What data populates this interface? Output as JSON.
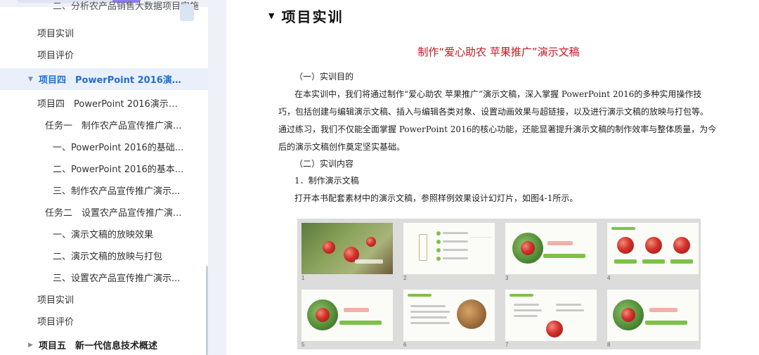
{
  "sidebar": {
    "items": [
      {
        "label": "二、分析农产品销售大数据项目实施",
        "level": "l3"
      },
      {
        "label": "项目实训",
        "level": "l1"
      },
      {
        "label": "项目评价",
        "level": "l1"
      },
      {
        "label": "项目四　PowerPoint 2016演示文...",
        "level": "chapter",
        "state": "expanded",
        "active": true
      },
      {
        "label": "项目四　PowerPoint 2016演示文...",
        "level": "l1"
      },
      {
        "label": "任务一　制作农产品宣传推广演...",
        "level": "l2"
      },
      {
        "label": "一、PowerPoint 2016的基础...",
        "level": "l3"
      },
      {
        "label": "二、PowerPoint 2016的基本...",
        "level": "l3"
      },
      {
        "label": "三、制作农产品宣传推广演示...",
        "level": "l3"
      },
      {
        "label": "任务二　设置农产品宣传推广演...",
        "level": "l2"
      },
      {
        "label": "一、演示文稿的放映效果",
        "level": "l3"
      },
      {
        "label": "二、演示文稿的放映与打包",
        "level": "l3"
      },
      {
        "label": "三、设置农产品宣传推广演示...",
        "level": "l3"
      },
      {
        "label": "项目实训",
        "level": "l1"
      },
      {
        "label": "项目评价",
        "level": "l1"
      },
      {
        "label": "项目五　新一代信息技术概述",
        "level": "chapter",
        "state": "collapsed"
      }
    ],
    "caret_expanded": "▼",
    "caret_collapsed": "▶"
  },
  "document": {
    "heading_marker": "▼",
    "heading": "项目实训",
    "title": "制作“爱心助农 苹果推广”演示文稿",
    "paragraphs": [
      "（一）实训目的",
      "在本实训中，我们将通过制作“爱心助农 苹果推广”演示文稿，深入掌握 PowerPoint 2016的多种实用操作技",
      "巧，包括创建与编辑演示文稿、插入与编辑各类对象、设置动画效果与超链接，以及进行演示文稿的放映与打包等。",
      "通过练习，我们不仅能全面掌握 PowerPoint 2016的核心功能，还能显著提升演示文稿的制作效率与整体质量，为今",
      "后的演示文稿创作奠定坚实基础。",
      "（二）实训内容",
      "1．制作演示文稿",
      "打开本书配套素材中的演示文稿，参照样例效果设计幻灯片，如图4-1所示。"
    ],
    "slides": [
      {
        "num": "1",
        "title": "爱心助农 苹果推广"
      },
      {
        "num": "2",
        "title": "目录"
      },
      {
        "num": "3",
        "title": "Part one",
        "subtitle": "爱心助农苹果义卖"
      },
      {
        "num": "4"
      },
      {
        "num": "5",
        "title": "Part two",
        "subtitle": "银行苹果助农"
      },
      {
        "num": "6"
      },
      {
        "num": "7"
      },
      {
        "num": "8",
        "title": "Part three",
        "subtitle": "扶贫助农苹果"
      }
    ]
  },
  "colors": {
    "accent_blue": "#1f6fd6",
    "title_red": "#c8161d",
    "slide_green": "#7cc246"
  }
}
